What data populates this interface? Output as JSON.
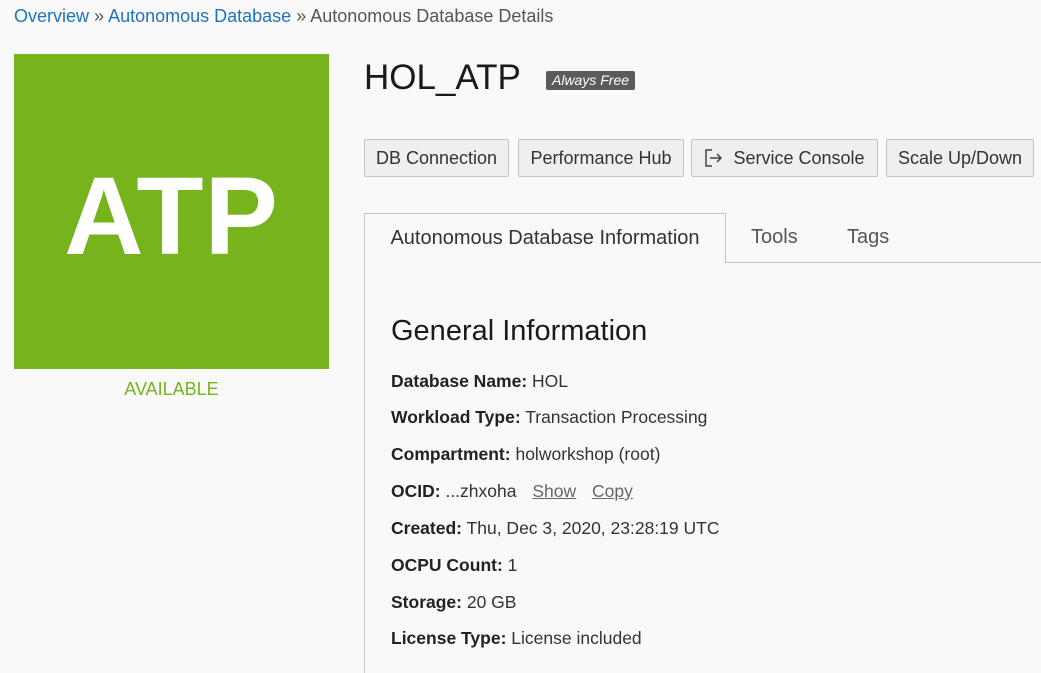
{
  "breadcrumb": {
    "items": [
      "Overview",
      "Autonomous Database"
    ],
    "separator": "»",
    "current": "Autonomous Database Details"
  },
  "logo": {
    "text": "ATP",
    "color": "#76b31d"
  },
  "lifecycle_state": "AVAILABLE",
  "title": "HOL_ATP",
  "badge": "Always Free",
  "buttons": {
    "db_connection": "DB Connection",
    "performance_hub": "Performance Hub",
    "service_console": "Service Console",
    "scale": "Scale Up/Down"
  },
  "tabs": {
    "info": "Autonomous Database Information",
    "tools": "Tools",
    "tags": "Tags"
  },
  "general": {
    "title": "General Information",
    "fields": [
      {
        "label": "Database Name:",
        "value": "HOL"
      },
      {
        "label": "Workload Type:",
        "value": "Transaction Processing"
      },
      {
        "label": "Compartment:",
        "value": "holworkshop (root)"
      },
      {
        "label": "OCID:",
        "value": "...zhxoha",
        "links": [
          "Show",
          "Copy"
        ]
      },
      {
        "label": "Created:",
        "value": "Thu, Dec 3, 2020, 23:28:19 UTC"
      },
      {
        "label": "OCPU Count:",
        "value": "1"
      },
      {
        "label": "Storage:",
        "value": "20 GB"
      },
      {
        "label": "License Type:",
        "value": "License included"
      }
    ]
  },
  "icons": {
    "service_console": "external-open-icon"
  }
}
